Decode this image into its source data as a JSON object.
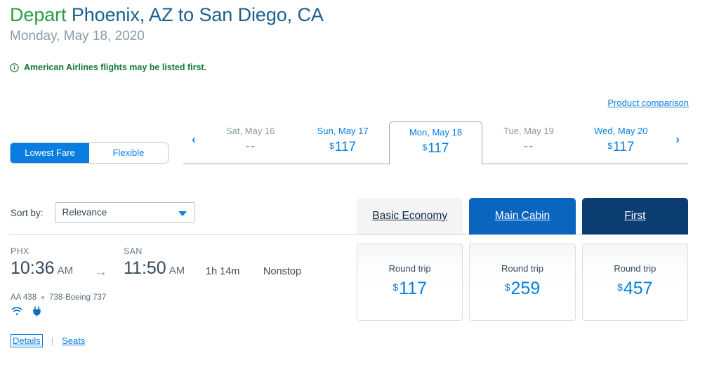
{
  "header": {
    "depart_word": "Depart",
    "route": " Phoenix, AZ to San Diego, CA",
    "date": "Monday, May 18, 2020"
  },
  "alert": {
    "icon": "info-circle-icon",
    "text": "American Airlines flights may be listed first."
  },
  "product_comparison_label": "Product comparison",
  "fare_toggle": {
    "lowest_label": "Lowest Fare",
    "flexible_label": "Flexible",
    "active": "Lowest Fare"
  },
  "date_strip": {
    "prev_icon": "‹",
    "next_icon": "›",
    "currency": "$",
    "unavailable_text": "--",
    "days": [
      {
        "label": "Sat, May 16",
        "price": "--",
        "available": false,
        "selected": false
      },
      {
        "label": "Sun, May 17",
        "price": "117",
        "available": true,
        "selected": false
      },
      {
        "label": "Mon, May 18",
        "price": "117",
        "available": true,
        "selected": true
      },
      {
        "label": "Tue, May 19",
        "price": "--",
        "available": false,
        "selected": false
      },
      {
        "label": "Wed, May 20",
        "price": "117",
        "available": true,
        "selected": false
      }
    ]
  },
  "sort": {
    "label": "Sort by:",
    "value": "Relevance",
    "options": [
      "Relevance"
    ]
  },
  "cabin_tabs": [
    {
      "label": "Basic Economy",
      "state": "inactive"
    },
    {
      "label": "Main Cabin",
      "state": "active"
    },
    {
      "label": "First",
      "state": "selected"
    }
  ],
  "flight": {
    "origin_code": "PHX",
    "depart_time": "10:36",
    "depart_meridiem": "AM",
    "arrow": "→",
    "dest_code": "SAN",
    "arrive_time": "11:50",
    "arrive_meridiem": "AM",
    "duration": "1h 14m",
    "stops": "Nonstop",
    "flight_number": "AA 438",
    "aircraft": "738-Boeing 737",
    "amenities": [
      "wifi-icon",
      "power-outlet-icon"
    ]
  },
  "fare_cards": [
    {
      "trip_type": "Round trip",
      "currency": "$",
      "amount": "117"
    },
    {
      "trip_type": "Round trip",
      "currency": "$",
      "amount": "259"
    },
    {
      "trip_type": "Round trip",
      "currency": "$",
      "amount": "457"
    }
  ],
  "footer": {
    "details_label": "Details",
    "separator": "|",
    "seats_label": "Seats"
  },
  "colors": {
    "brand_green": "#2e9d46",
    "brand_blue": "#1a5f8f",
    "link_blue": "#0a7de0",
    "main_cabin_blue": "#0a65bf",
    "first_navy": "#0b3c72",
    "basic_gray": "#f2f4f6"
  }
}
